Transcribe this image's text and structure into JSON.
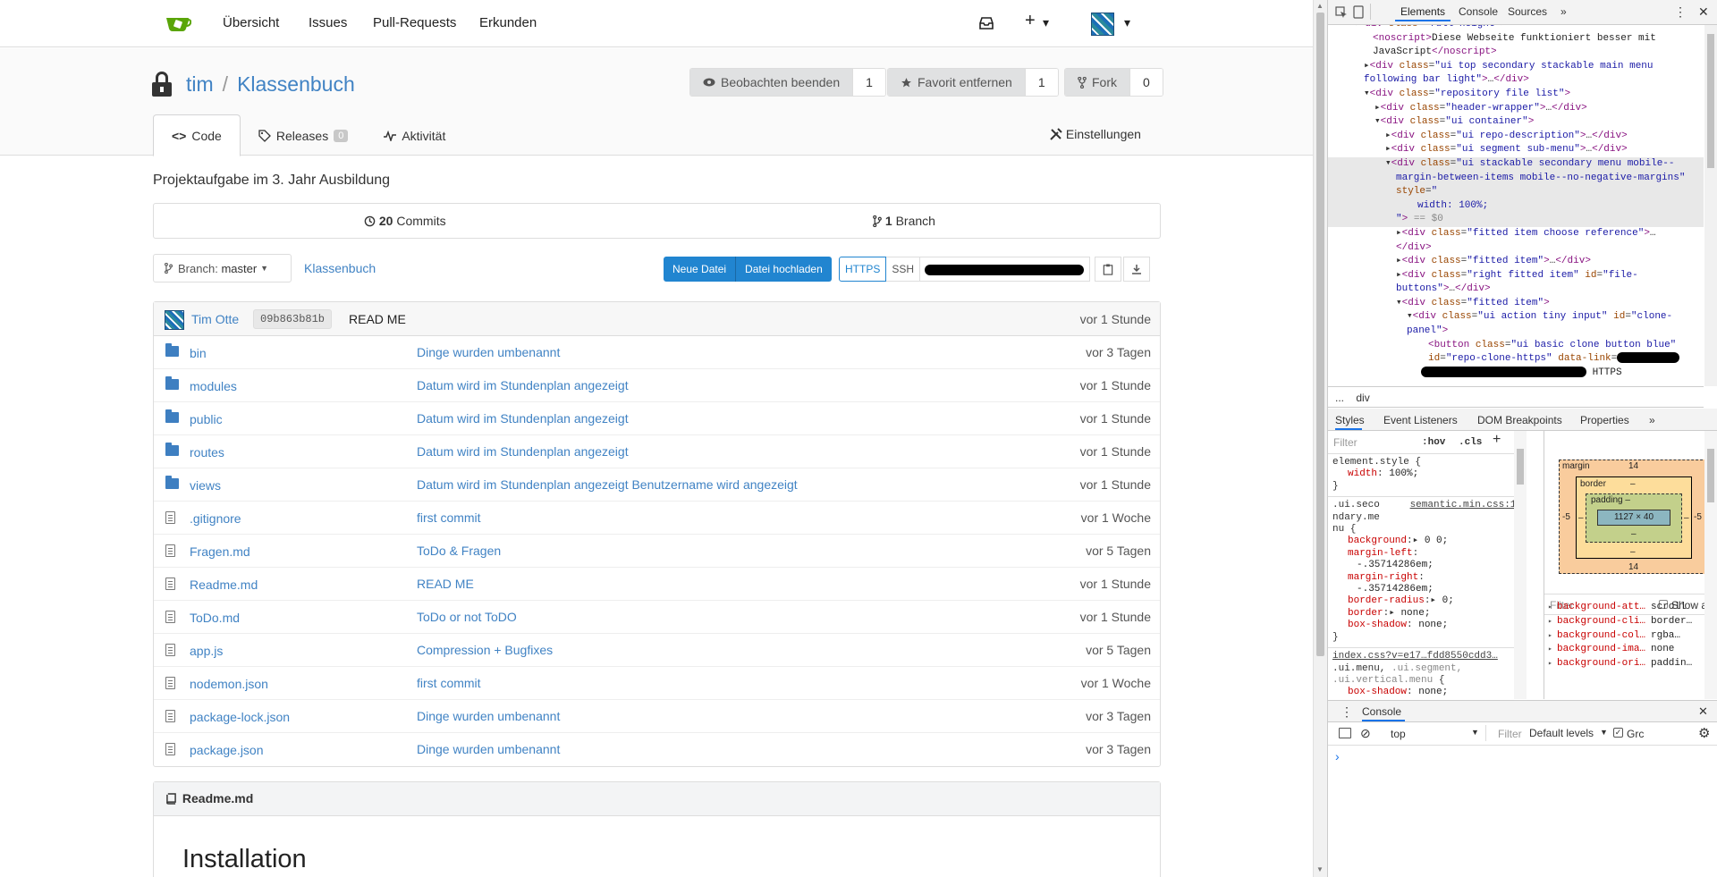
{
  "nav": {
    "links": [
      "Übersicht",
      "Issues",
      "Pull-Requests",
      "Erkunden"
    ],
    "plus": "+",
    "caret": "▾"
  },
  "repo": {
    "owner": "tim",
    "separator": "/",
    "name": "Klassenbuch",
    "watch": {
      "label": "Beobachten beenden",
      "count": "1"
    },
    "star": {
      "label": "Favorit entfernen",
      "count": "1"
    },
    "fork": {
      "label": "Fork",
      "count": "0"
    },
    "tabs": {
      "code": "Code",
      "releases": "Releases",
      "releases_count": "0",
      "activity": "Aktivität"
    },
    "settings": "Einstellungen",
    "description": "Projektaufgabe im 3. Jahr Ausbildung",
    "commits_count": "20",
    "commits_label": "Commits",
    "branch_count": "1",
    "branch_label": "Branch",
    "branch_prefix": "Branch:",
    "branch_name": "master",
    "breadcrumb": "Klassenbuch",
    "new_file": "Neue Datei",
    "upload_file": "Datei hochladen",
    "https": "HTTPS",
    "ssh": "SSH"
  },
  "latest_commit": {
    "author": "Tim Otte",
    "sha": "09b863b81b",
    "message": "READ ME",
    "time": "vor 1 Stunde"
  },
  "files": [
    {
      "name": "bin",
      "type": "folder",
      "message": "Dinge wurden umbenannt",
      "time": "vor 3 Tagen"
    },
    {
      "name": "modules",
      "type": "folder",
      "message": "Datum wird im Stundenplan angezeigt",
      "time": "vor 1 Stunde"
    },
    {
      "name": "public",
      "type": "folder",
      "message": "Datum wird im Stundenplan angezeigt",
      "time": "vor 1 Stunde"
    },
    {
      "name": "routes",
      "type": "folder",
      "message": "Datum wird im Stundenplan angezeigt",
      "time": "vor 1 Stunde"
    },
    {
      "name": "views",
      "type": "folder",
      "message": "Datum wird im Stundenplan angezeigt Benutzername wird angezeigt",
      "time": "vor 1 Stunde"
    },
    {
      "name": ".gitignore",
      "type": "file",
      "message": "first commit",
      "time": "vor 1 Woche"
    },
    {
      "name": "Fragen.md",
      "type": "file",
      "message": "ToDo & Fragen",
      "time": "vor 5 Tagen"
    },
    {
      "name": "Readme.md",
      "type": "file",
      "message": "READ ME",
      "time": "vor 1 Stunde"
    },
    {
      "name": "ToDo.md",
      "type": "file",
      "message": "ToDo or not ToDO",
      "time": "vor 1 Stunde"
    },
    {
      "name": "app.js",
      "type": "file",
      "message": "Compression + Bugfixes",
      "time": "vor 5 Tagen"
    },
    {
      "name": "nodemon.json",
      "type": "file",
      "message": "first commit",
      "time": "vor 1 Woche"
    },
    {
      "name": "package-lock.json",
      "type": "file",
      "message": "Dinge wurden umbenannt",
      "time": "vor 3 Tagen"
    },
    {
      "name": "package.json",
      "type": "file",
      "message": "Dinge wurden umbenannt",
      "time": "vor 3 Tagen"
    }
  ],
  "readme": {
    "filename": "Readme.md",
    "heading": "Installation"
  },
  "devtools": {
    "tabs": [
      "Elements",
      "Console",
      "Sources",
      "»"
    ],
    "crumbs": [
      "...",
      "div"
    ],
    "subtabs": [
      "Styles",
      "Event Listeners",
      "DOM Breakpoints",
      "Properties",
      "»"
    ],
    "filter_placeholder": "Filter",
    "hov": ":hov",
    "cls": ".cls",
    "add": "+",
    "boxmodel": {
      "margin_label": "margin",
      "margin_top": "14",
      "margin_bottom": "14",
      "margin_left": "-5",
      "margin_right": "-5",
      "border_label": "border",
      "dash": "–",
      "padding_label": "padding –",
      "content": "1127 × 40"
    },
    "computed_filter": "Filter",
    "show_all": "Show all",
    "computed": [
      {
        "name": "background-att…",
        "value": "scroll"
      },
      {
        "name": "background-cli…",
        "value": "border…"
      },
      {
        "name": "background-col…",
        "value": "rgba…"
      },
      {
        "name": "background-ima…",
        "value": "none"
      },
      {
        "name": "background-ori…",
        "value": "paddin…"
      }
    ],
    "console_title": "Console",
    "console_context": "top",
    "console_filter": "Filter",
    "console_levels": "Default levels",
    "console_group": "Grc",
    "prompt": "›"
  }
}
